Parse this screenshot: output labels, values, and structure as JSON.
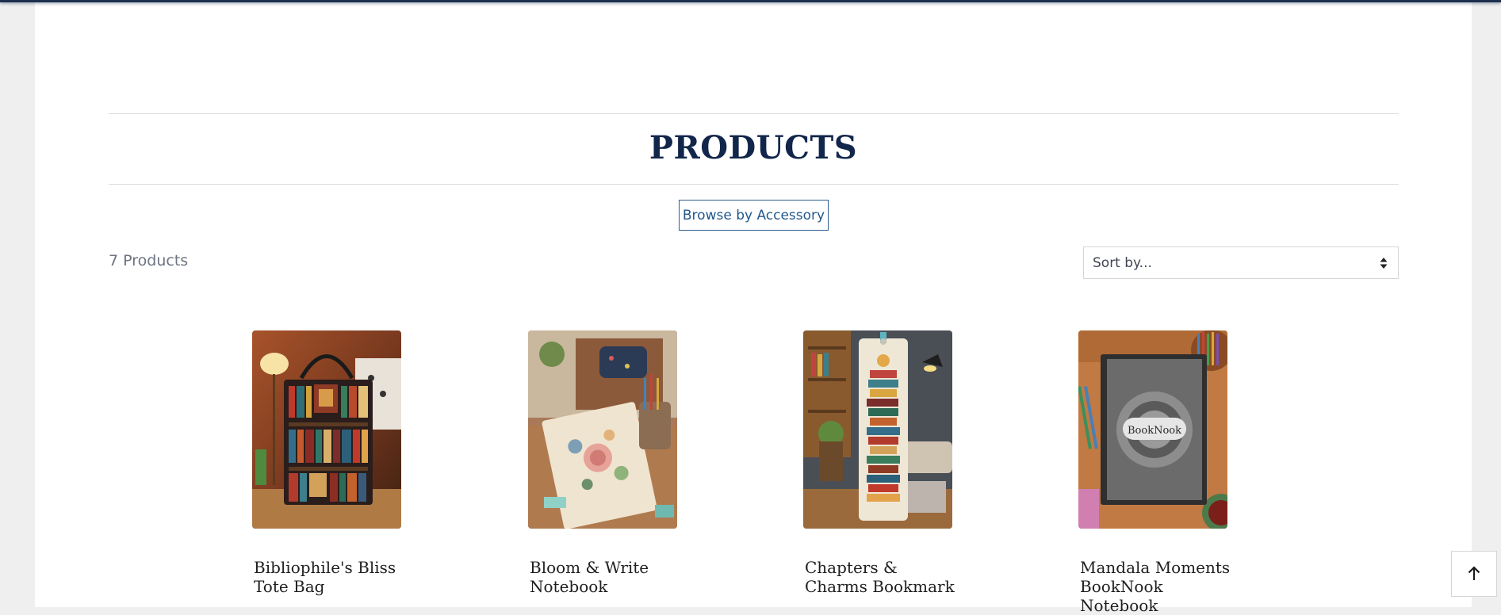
{
  "section": {
    "title": "PRODUCTS",
    "browse_button_label": "Browse by Accessory"
  },
  "toolbar": {
    "count_text": "7 Products",
    "sort_select_value": "Sort by..."
  },
  "products": [
    {
      "name_line1": "Bibliophile's Bliss",
      "name_line2": "Tote Bag",
      "name_line3": ""
    },
    {
      "name_line1": "Bloom & Write",
      "name_line2": "Notebook",
      "name_line3": ""
    },
    {
      "name_line1": "Chapters &",
      "name_line2": "Charms Bookmark",
      "name_line3": ""
    },
    {
      "name_line1": "Mandala Moments",
      "name_line2": "BookNook",
      "name_line3": "Notebook"
    }
  ],
  "icons": {
    "sort": "sort-arrows-icon",
    "scroll_top": "arrow-up-icon"
  },
  "colors": {
    "title": "#12264b",
    "accent": "#23598c",
    "muted_text": "#6d7480",
    "page_bg": "#efefef"
  }
}
